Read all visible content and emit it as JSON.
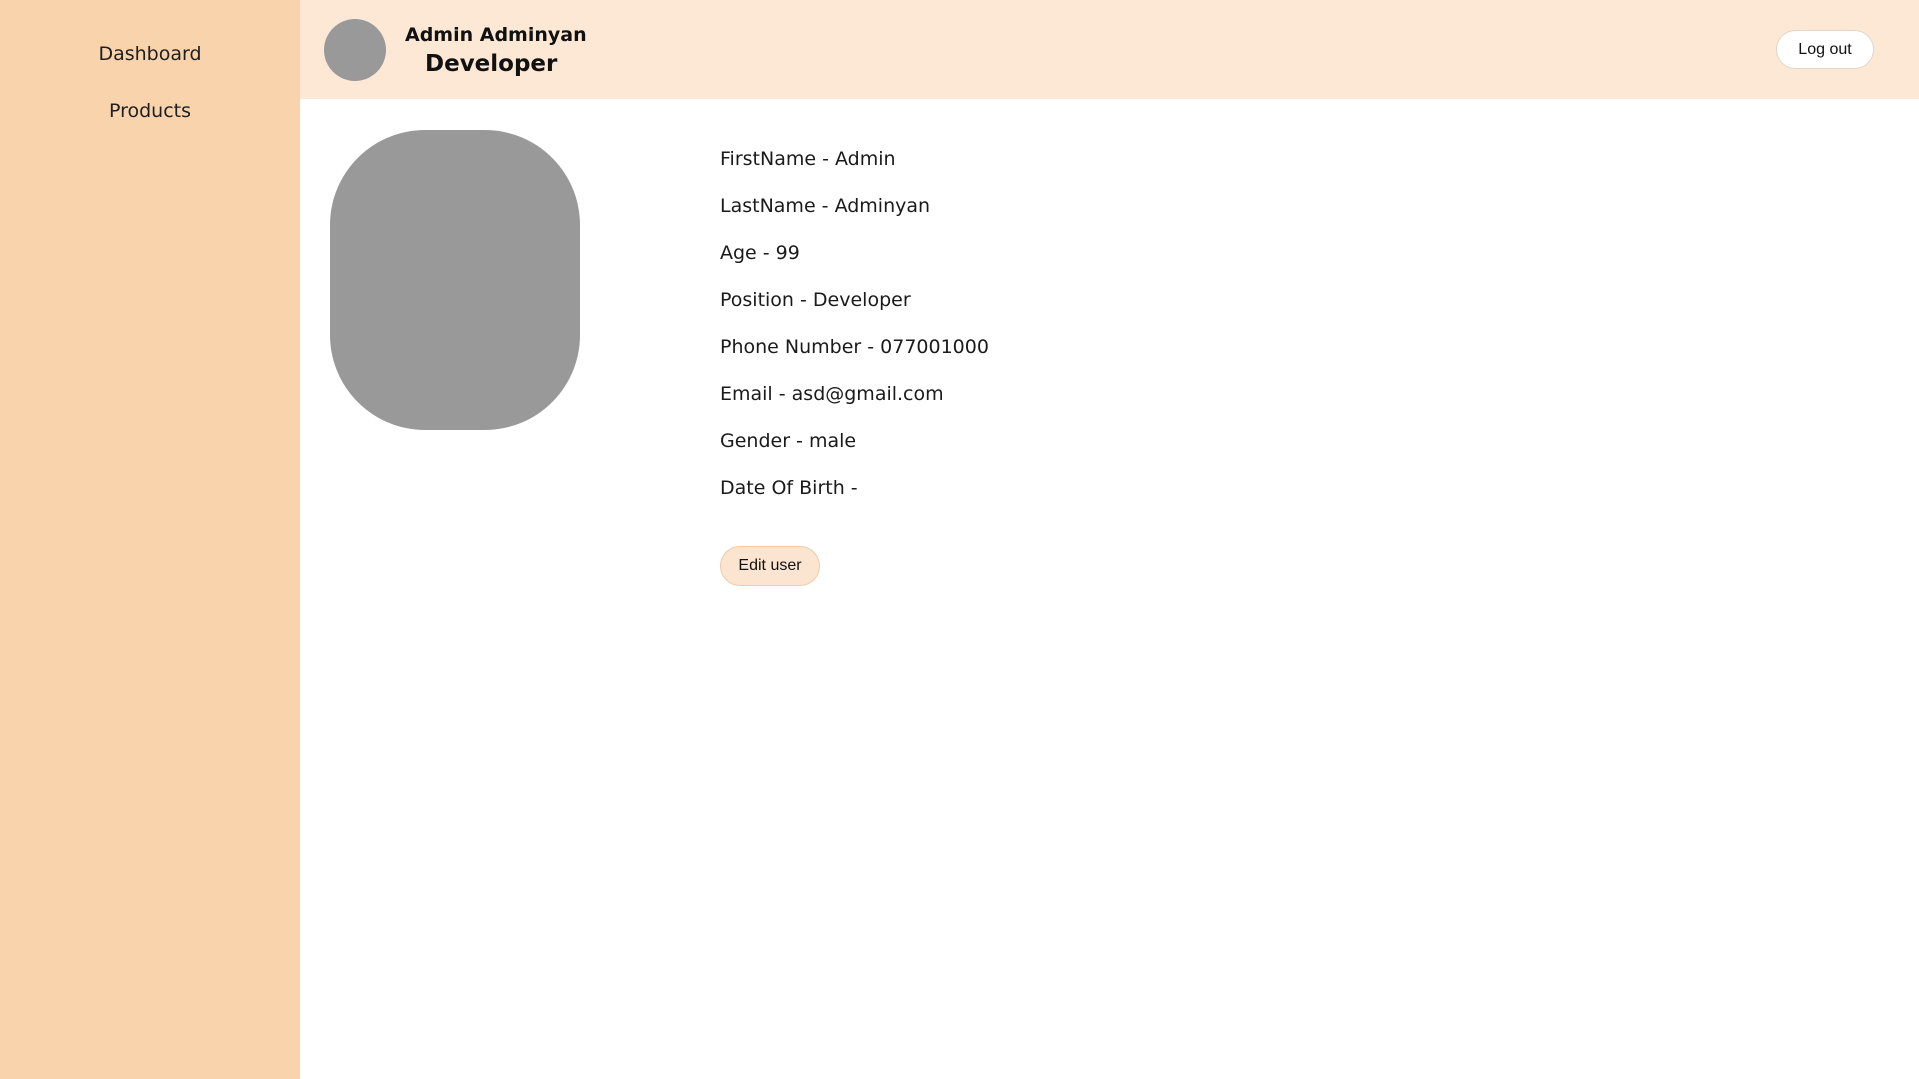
{
  "sidebar": {
    "items": [
      {
        "label": "Dashboard"
      },
      {
        "label": "Products"
      }
    ]
  },
  "header": {
    "user_name": "Admin Adminyan",
    "user_role": "Developer",
    "logout_label": "Log out"
  },
  "profile": {
    "fields": [
      {
        "text": "FirstName - Admin"
      },
      {
        "text": "LastName - Adminyan"
      },
      {
        "text": "Age - 99"
      },
      {
        "text": "Position - Developer"
      },
      {
        "text": "Phone Number - 077001000"
      },
      {
        "text": "Email - asd@gmail.com"
      },
      {
        "text": "Gender - male"
      },
      {
        "text": "Date Of Birth -"
      }
    ],
    "edit_label": "Edit user"
  },
  "colors": {
    "sidebar_bg": "#f8d3ab",
    "header_bg": "#fce8d4",
    "avatar_placeholder": "#999999",
    "edit_button_bg": "#fce5d0"
  }
}
